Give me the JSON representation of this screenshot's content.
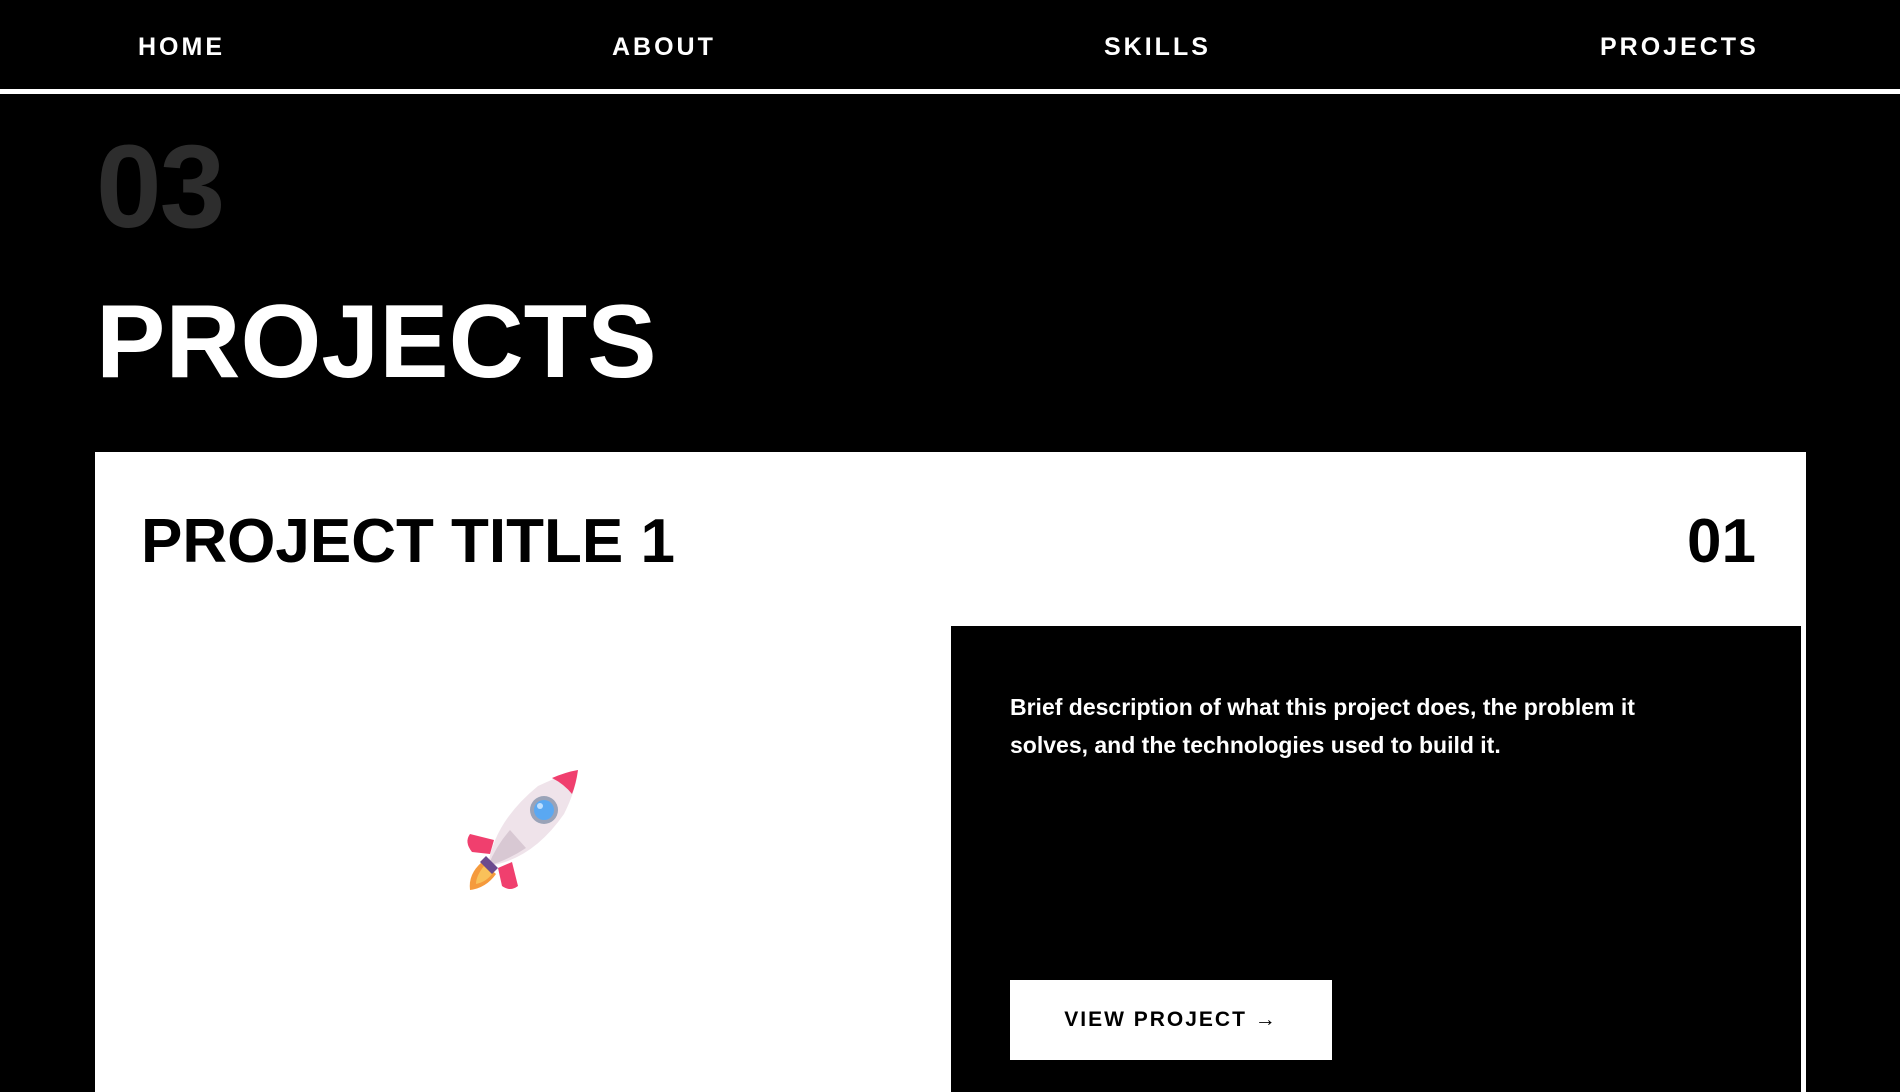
{
  "nav": {
    "items": [
      {
        "label": "HOME"
      },
      {
        "label": "ABOUT"
      },
      {
        "label": "SKILLS"
      },
      {
        "label": "PROJECTS"
      }
    ]
  },
  "section": {
    "number": "03",
    "title": "PROJECTS"
  },
  "projects": [
    {
      "title": "PROJECT TITLE 1",
      "number": "01",
      "icon": "rocket-icon",
      "description": "Brief description of what this project does, the problem it solves, and the technologies used to build it.",
      "button_label": "VIEW PROJECT →"
    }
  ],
  "colors": {
    "background": "#000000",
    "text_primary": "#ffffff",
    "section_number": "#2d2d2d",
    "card_background": "#ffffff",
    "rocket_body": "#efe3ea",
    "rocket_fin": "#f03f6e",
    "rocket_window": "#5aa8f2",
    "rocket_flame": "#f59a3c"
  }
}
